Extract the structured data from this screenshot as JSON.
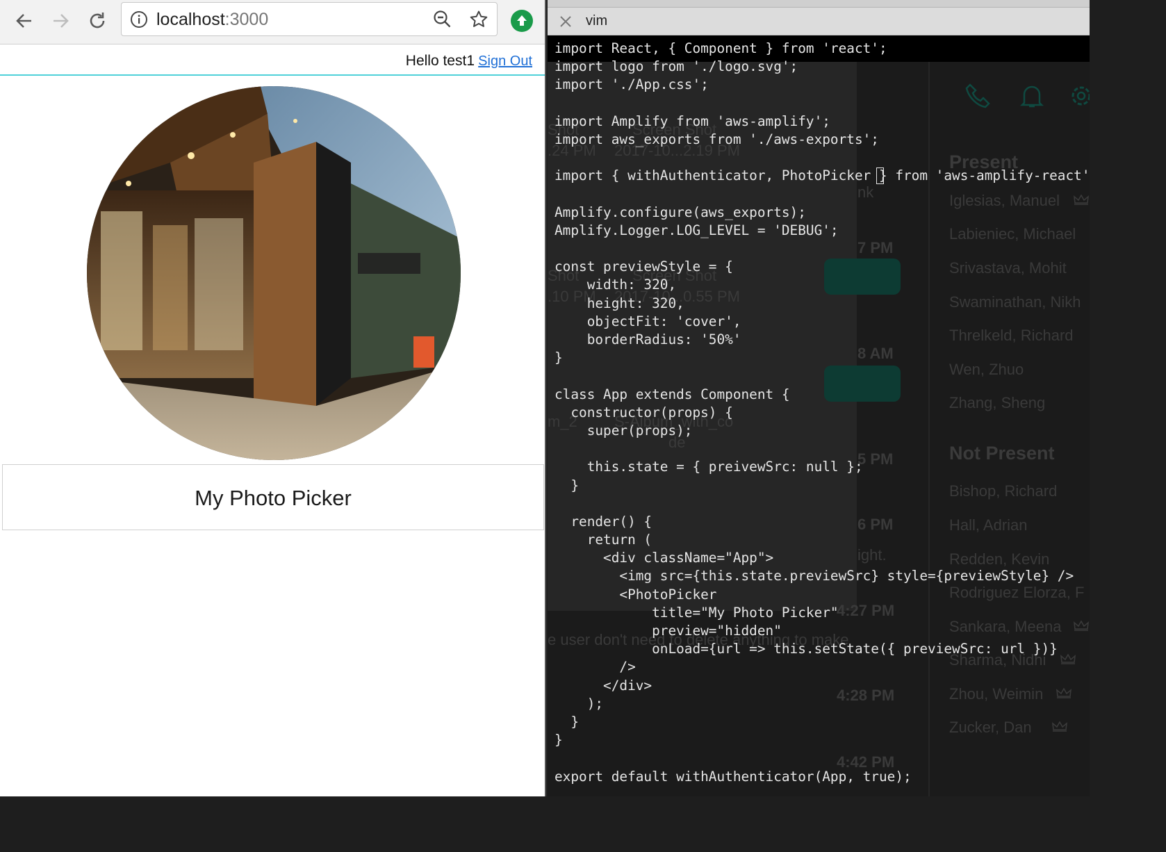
{
  "browser": {
    "address": {
      "host": "localhost",
      "port": ":3000"
    }
  },
  "page": {
    "greeting": "Hello test1",
    "sign_out_label": "Sign Out",
    "photo_picker_title": "My Photo Picker"
  },
  "vim": {
    "tab_title": "vim",
    "code_lines": [
      "import React, { Component } from 'react';",
      "import logo from './logo.svg';",
      "import './App.css';",
      "",
      "import Amplify from 'aws-amplify';",
      "import aws_exports from './aws-exports';",
      "",
      "import { withAuthenticator, PhotoPicker } from 'aws-amplify-react';",
      "",
      "Amplify.configure(aws_exports);",
      "Amplify.Logger.LOG_LEVEL = 'DEBUG';",
      "",
      "const previewStyle = {",
      "    width: 320,",
      "    height: 320,",
      "    objectFit: 'cover',",
      "    borderRadius: '50%'",
      "}",
      "",
      "class App extends Component {",
      "  constructor(props) {",
      "    super(props);",
      "",
      "    this.state = { preivewSrc: null };",
      "  }",
      "",
      "  render() {",
      "    return (",
      "      <div className=\"App\">",
      "        <img src={this.state.previewSrc} style={previewStyle} />",
      "        <PhotoPicker",
      "            title=\"My Photo Picker\"",
      "            preview=\"hidden\"",
      "            onLoad={url => this.setState({ previewSrc: url })}",
      "        />",
      "      </div>",
      "    );",
      "  }",
      "}",
      "",
      "export default withAuthenticator(App, true);"
    ]
  },
  "background_app": {
    "present_heading": "Present",
    "present_names": [
      "Iglesias, Manuel",
      "Labieniec, Michael",
      "Srivastava, Mohit",
      "Swaminathan, Nikh",
      "Threlkeld, Richard",
      "Wen, Zhuo",
      "Zhang, Sheng"
    ],
    "not_present_heading": "Not Present",
    "not_present_names": [
      "Bishop, Richard",
      "Hall, Adrian",
      "Redden, Kevin",
      "Rodriguez Elorza, F",
      "Sankara, Meena",
      "Sharma, Nidhi",
      "Zhou, Weimin",
      "Zucker, Dan"
    ],
    "times": [
      "7 PM",
      "8 AM",
      "5 PM",
      "6 PM",
      "4:27 PM",
      "4:28 PM",
      "4:42 PM"
    ],
    "files": [
      "Shot",
      ".24 PM",
      "Screen Shot",
      "2017-10...2.19 PM",
      "Shot",
      ".10 PM",
      "Screen Shot",
      "2017-10...0.55 PM",
      "m_2",
      "S-Album_with_co",
      "de",
      "nk",
      "ight."
    ],
    "chat_fragment": "e user don't need to delete anything to make"
  },
  "colors": {
    "link": "#1f6fd6",
    "header_rule": "#4fd1d9",
    "update_badge": "#1a9b4a"
  }
}
